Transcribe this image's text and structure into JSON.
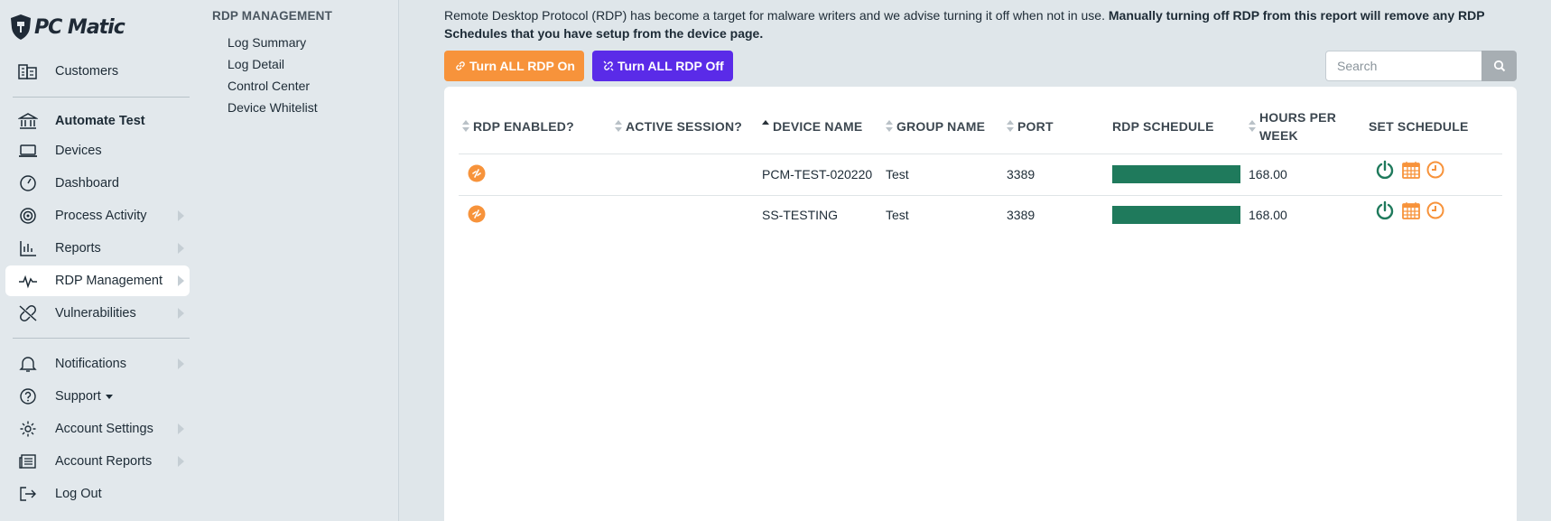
{
  "brand": {
    "name": "PC Matic"
  },
  "nav": {
    "items": [
      {
        "label": "Customers",
        "icon": "buildings-icon"
      },
      {
        "label": "Automate Test",
        "icon": "bank-icon"
      },
      {
        "label": "Devices",
        "icon": "laptop-icon"
      },
      {
        "label": "Dashboard",
        "icon": "gauge-icon"
      },
      {
        "label": "Process Activity",
        "icon": "target-icon"
      },
      {
        "label": "Reports",
        "icon": "bar-chart-icon"
      },
      {
        "label": "RDP Management",
        "icon": "pulse-icon"
      },
      {
        "label": "Vulnerabilities",
        "icon": "broken-link-icon"
      },
      {
        "label": "Notifications",
        "icon": "bell-icon"
      },
      {
        "label": "Support",
        "icon": "question-circle-icon"
      },
      {
        "label": "Account Settings",
        "icon": "gear-icon"
      },
      {
        "label": "Account Reports",
        "icon": "newspaper-icon"
      },
      {
        "label": "Log Out",
        "icon": "logout-icon"
      }
    ]
  },
  "subnav": {
    "title": "RDP MANAGEMENT",
    "links": [
      "Log Summary",
      "Log Detail",
      "Control Center",
      "Device Whitelist"
    ]
  },
  "notice": {
    "text": "Remote Desktop Protocol (RDP) has become a target for malware writers and we advise turning it off when not in use. ",
    "bold": "Manually turning off RDP from this report will remove any RDP Schedules that you have setup from the device page."
  },
  "actions": {
    "on_label": "Turn ALL RDP On",
    "off_label": "Turn ALL RDP Off",
    "search_placeholder": "Search"
  },
  "table": {
    "headers": {
      "rdp_enabled": "RDP ENABLED?",
      "active_session": "ACTIVE SESSION?",
      "device_name": "DEVICE NAME",
      "group_name": "GROUP NAME",
      "port": "PORT",
      "rdp_schedule": "RDP SCHEDULE",
      "hours_line1": "HOURS PER",
      "hours_line2": "WEEK",
      "set_schedule": "SET SCHEDULE"
    },
    "rows": [
      {
        "device": "PCM-TEST-020220",
        "group": "Test",
        "port": "3389",
        "hours": "168.00",
        "schedule_fill": 1.0
      },
      {
        "device": "SS-TESTING",
        "group": "Test",
        "port": "3389",
        "hours": "168.00",
        "schedule_fill": 1.0
      }
    ]
  },
  "colors": {
    "orange": "#f7933b",
    "purple": "#5a2be8",
    "green": "#1f7a5c"
  }
}
